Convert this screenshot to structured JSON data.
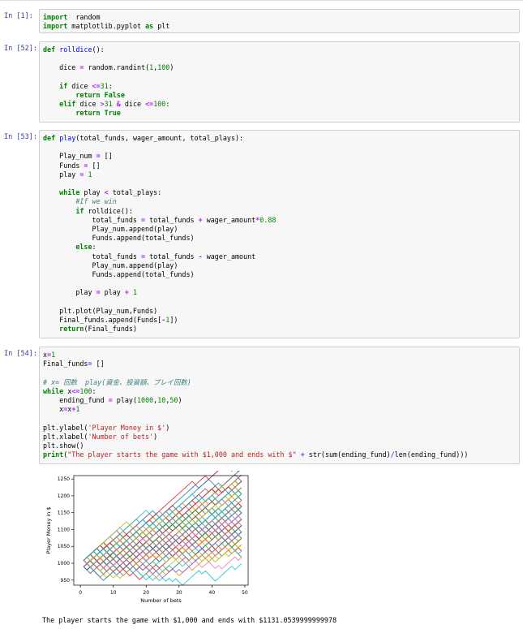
{
  "cells": [
    {
      "prompt": "In [1]:",
      "lines": [
        [
          [
            "kw",
            "import"
          ],
          [
            "",
            "  random"
          ]
        ],
        [
          [
            "kw",
            "import"
          ],
          [
            "",
            " matplotlib.pyplot "
          ],
          [
            "kw",
            "as"
          ],
          [
            "",
            " plt"
          ]
        ]
      ]
    },
    {
      "prompt": "In [52]:",
      "lines": [
        [
          [
            "kw",
            "def"
          ],
          [
            "",
            " "
          ],
          [
            "fn",
            "rolldice"
          ],
          [
            "",
            "():"
          ]
        ],
        [
          [
            "",
            ""
          ]
        ],
        [
          [
            "",
            "    dice "
          ],
          [
            "op",
            "="
          ],
          [
            "",
            " random.randint("
          ],
          [
            "num",
            "1"
          ],
          [
            "",
            ","
          ],
          [
            "num",
            "100"
          ],
          [
            "",
            ")"
          ]
        ],
        [
          [
            "",
            ""
          ]
        ],
        [
          [
            "",
            "    "
          ],
          [
            "kw",
            "if"
          ],
          [
            "",
            " dice "
          ],
          [
            "op",
            "<="
          ],
          [
            "num",
            "31"
          ],
          [
            "",
            ":"
          ]
        ],
        [
          [
            "",
            "        "
          ],
          [
            "kw",
            "return"
          ],
          [
            "",
            " "
          ],
          [
            "kw",
            "False"
          ]
        ],
        [
          [
            "",
            "    "
          ],
          [
            "kw",
            "elif"
          ],
          [
            "",
            " dice "
          ],
          [
            "op",
            ">"
          ],
          [
            "num",
            "31"
          ],
          [
            "",
            " "
          ],
          [
            "op",
            "&"
          ],
          [
            "",
            " dice "
          ],
          [
            "op",
            "<="
          ],
          [
            "num",
            "100"
          ],
          [
            "",
            ":"
          ]
        ],
        [
          [
            "",
            "        "
          ],
          [
            "kw",
            "return"
          ],
          [
            "",
            " "
          ],
          [
            "kw",
            "True"
          ]
        ]
      ]
    },
    {
      "prompt": "In [53]:",
      "lines": [
        [
          [
            "kw",
            "def"
          ],
          [
            "",
            " "
          ],
          [
            "fn",
            "play"
          ],
          [
            "",
            "(total_funds, wager_amount, total_plays):"
          ]
        ],
        [
          [
            "",
            ""
          ]
        ],
        [
          [
            "",
            "    Play_num "
          ],
          [
            "op",
            "="
          ],
          [
            "",
            " []"
          ]
        ],
        [
          [
            "",
            "    Funds "
          ],
          [
            "op",
            "="
          ],
          [
            "",
            " []"
          ]
        ],
        [
          [
            "",
            "    play "
          ],
          [
            "op",
            "="
          ],
          [
            "",
            " "
          ],
          [
            "num",
            "1"
          ]
        ],
        [
          [
            "",
            ""
          ]
        ],
        [
          [
            "",
            "    "
          ],
          [
            "kw",
            "while"
          ],
          [
            "",
            " play "
          ],
          [
            "op",
            "<"
          ],
          [
            "",
            " total_plays:"
          ]
        ],
        [
          [
            "",
            "        "
          ],
          [
            "cm",
            "#If we win"
          ]
        ],
        [
          [
            "",
            "        "
          ],
          [
            "kw",
            "if"
          ],
          [
            "",
            " rolldice():"
          ]
        ],
        [
          [
            "",
            "            total_funds "
          ],
          [
            "op",
            "="
          ],
          [
            "",
            " total_funds "
          ],
          [
            "op",
            "+"
          ],
          [
            "",
            " wager_amount"
          ],
          [
            "op",
            "*"
          ],
          [
            "num",
            "0.88"
          ]
        ],
        [
          [
            "",
            "            Play_num.append(play)"
          ]
        ],
        [
          [
            "",
            "            Funds.append(total_funds)"
          ]
        ],
        [
          [
            "",
            "        "
          ],
          [
            "kw",
            "else"
          ],
          [
            "",
            ":"
          ]
        ],
        [
          [
            "",
            "            total_funds "
          ],
          [
            "op",
            "="
          ],
          [
            "",
            " total_funds "
          ],
          [
            "op",
            "-"
          ],
          [
            "",
            " wager_amount"
          ]
        ],
        [
          [
            "",
            "            Play_num.append(play)"
          ]
        ],
        [
          [
            "",
            "            Funds.append(total_funds)"
          ]
        ],
        [
          [
            "",
            ""
          ]
        ],
        [
          [
            "",
            "        play "
          ],
          [
            "op",
            "="
          ],
          [
            "",
            " play "
          ],
          [
            "op",
            "+"
          ],
          [
            "",
            " "
          ],
          [
            "num",
            "1"
          ]
        ],
        [
          [
            "",
            ""
          ]
        ],
        [
          [
            "",
            "    plt.plot(Play_num,Funds)"
          ]
        ],
        [
          [
            "",
            "    Final_funds.append(Funds["
          ],
          [
            "op",
            "-"
          ],
          [
            "num",
            "1"
          ],
          [
            "",
            "])"
          ]
        ],
        [
          [
            "",
            "    "
          ],
          [
            "kw",
            "return"
          ],
          [
            "",
            "(Final_funds)"
          ]
        ]
      ]
    },
    {
      "prompt": "In [54]:",
      "lines": [
        [
          [
            "",
            "x"
          ],
          [
            "op",
            "="
          ],
          [
            "num",
            "1"
          ]
        ],
        [
          [
            "",
            "Final_funds"
          ],
          [
            "op",
            "="
          ],
          [
            "",
            " []"
          ]
        ],
        [
          [
            "",
            ""
          ]
        ],
        [
          [
            "cm",
            "# x= 回数  play(資金、投資額、プレイ回数)"
          ]
        ],
        [
          [
            "kw",
            "while"
          ],
          [
            "",
            " x"
          ],
          [
            "op",
            "<="
          ],
          [
            "num",
            "100"
          ],
          [
            "",
            ":"
          ]
        ],
        [
          [
            "",
            "    ending_fund "
          ],
          [
            "op",
            "="
          ],
          [
            "",
            " play("
          ],
          [
            "num",
            "1000"
          ],
          [
            "",
            ","
          ],
          [
            "num",
            "10"
          ],
          [
            "",
            ","
          ],
          [
            "num",
            "50"
          ],
          [
            "",
            ")"
          ]
        ],
        [
          [
            "",
            "    x"
          ],
          [
            "op",
            "="
          ],
          [
            "",
            "x"
          ],
          [
            "op",
            "+"
          ],
          [
            "num",
            "1"
          ]
        ],
        [
          [
            "",
            ""
          ]
        ],
        [
          [
            "",
            "plt.ylabel("
          ],
          [
            "str",
            "'Player Money in $'"
          ],
          [
            "",
            ")"
          ]
        ],
        [
          [
            "",
            "plt.xlabel("
          ],
          [
            "str",
            "'Number of bets'"
          ],
          [
            "",
            ")"
          ]
        ],
        [
          [
            "",
            "plt.show()"
          ]
        ],
        [
          [
            "kw",
            "print"
          ],
          [
            "",
            "("
          ],
          [
            "str",
            "\"The player starts the game with $1,000 and ends with $\""
          ],
          [
            "",
            " "
          ],
          [
            "op",
            "+"
          ],
          [
            "",
            " str(sum(ending_fund)"
          ],
          [
            "op",
            "/"
          ],
          [
            "",
            "len(ending_fund)))"
          ]
        ]
      ]
    }
  ],
  "output_text": "The player starts the game with $1,000 and ends with $1131.0539999999978",
  "chart_data": {
    "type": "line",
    "xlabel": "Number of bets",
    "ylabel": "Player Money in $",
    "xlim": [
      -2,
      51
    ],
    "ylim": [
      935,
      1260
    ],
    "xticks": [
      0,
      10,
      20,
      30,
      40,
      50
    ],
    "yticks": [
      950,
      1000,
      1050,
      1100,
      1150,
      1200,
      1250
    ],
    "series_count": 100,
    "start_value": 1000,
    "win_step": 8.8,
    "loss_step": -10,
    "final_range_observed": [
      955,
      1252
    ],
    "colors": [
      "#1f77b4",
      "#ff7f0e",
      "#2ca02c",
      "#d62728",
      "#9467bd",
      "#8c564b",
      "#e377c2",
      "#7f7f7f",
      "#bcbd22",
      "#17becf"
    ]
  }
}
